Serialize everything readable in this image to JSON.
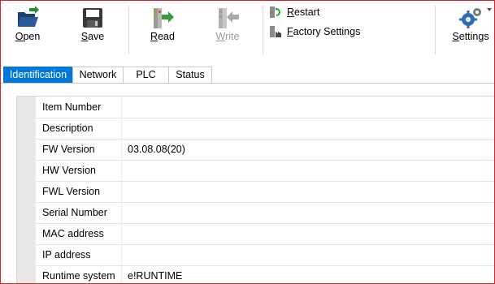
{
  "toolbar": {
    "open_label": "Open",
    "save_label": "Save",
    "read_label": "Read",
    "write_label": "Write",
    "restart_label": "Restart",
    "factory_settings_label": "Factory Settings",
    "settings_label": "Settings"
  },
  "tabs": [
    {
      "label": "Identification",
      "active": true
    },
    {
      "label": "Network",
      "active": false
    },
    {
      "label": "PLC",
      "active": false
    },
    {
      "label": "Status",
      "active": false
    }
  ],
  "properties": [
    {
      "name": "Item Number",
      "value": ""
    },
    {
      "name": "Description",
      "value": ""
    },
    {
      "name": "FW Version",
      "value": "03.08.08(20)"
    },
    {
      "name": "HW Version",
      "value": ""
    },
    {
      "name": "FWL Version",
      "value": ""
    },
    {
      "name": "Serial Number",
      "value": ""
    },
    {
      "name": "MAC address",
      "value": ""
    },
    {
      "name": "IP address",
      "value": ""
    },
    {
      "name": "Runtime system",
      "value": "e!RUNTIME"
    }
  ],
  "colors": {
    "accent": "#0078d7",
    "border_highlight": "#e0202a"
  },
  "icons": {
    "open": "folder-open-icon",
    "save": "floppy-disk-icon",
    "read": "read-device-icon",
    "write": "write-device-icon",
    "restart": "restart-icon",
    "factory_settings": "factory-settings-icon",
    "settings": "gears-icon"
  }
}
